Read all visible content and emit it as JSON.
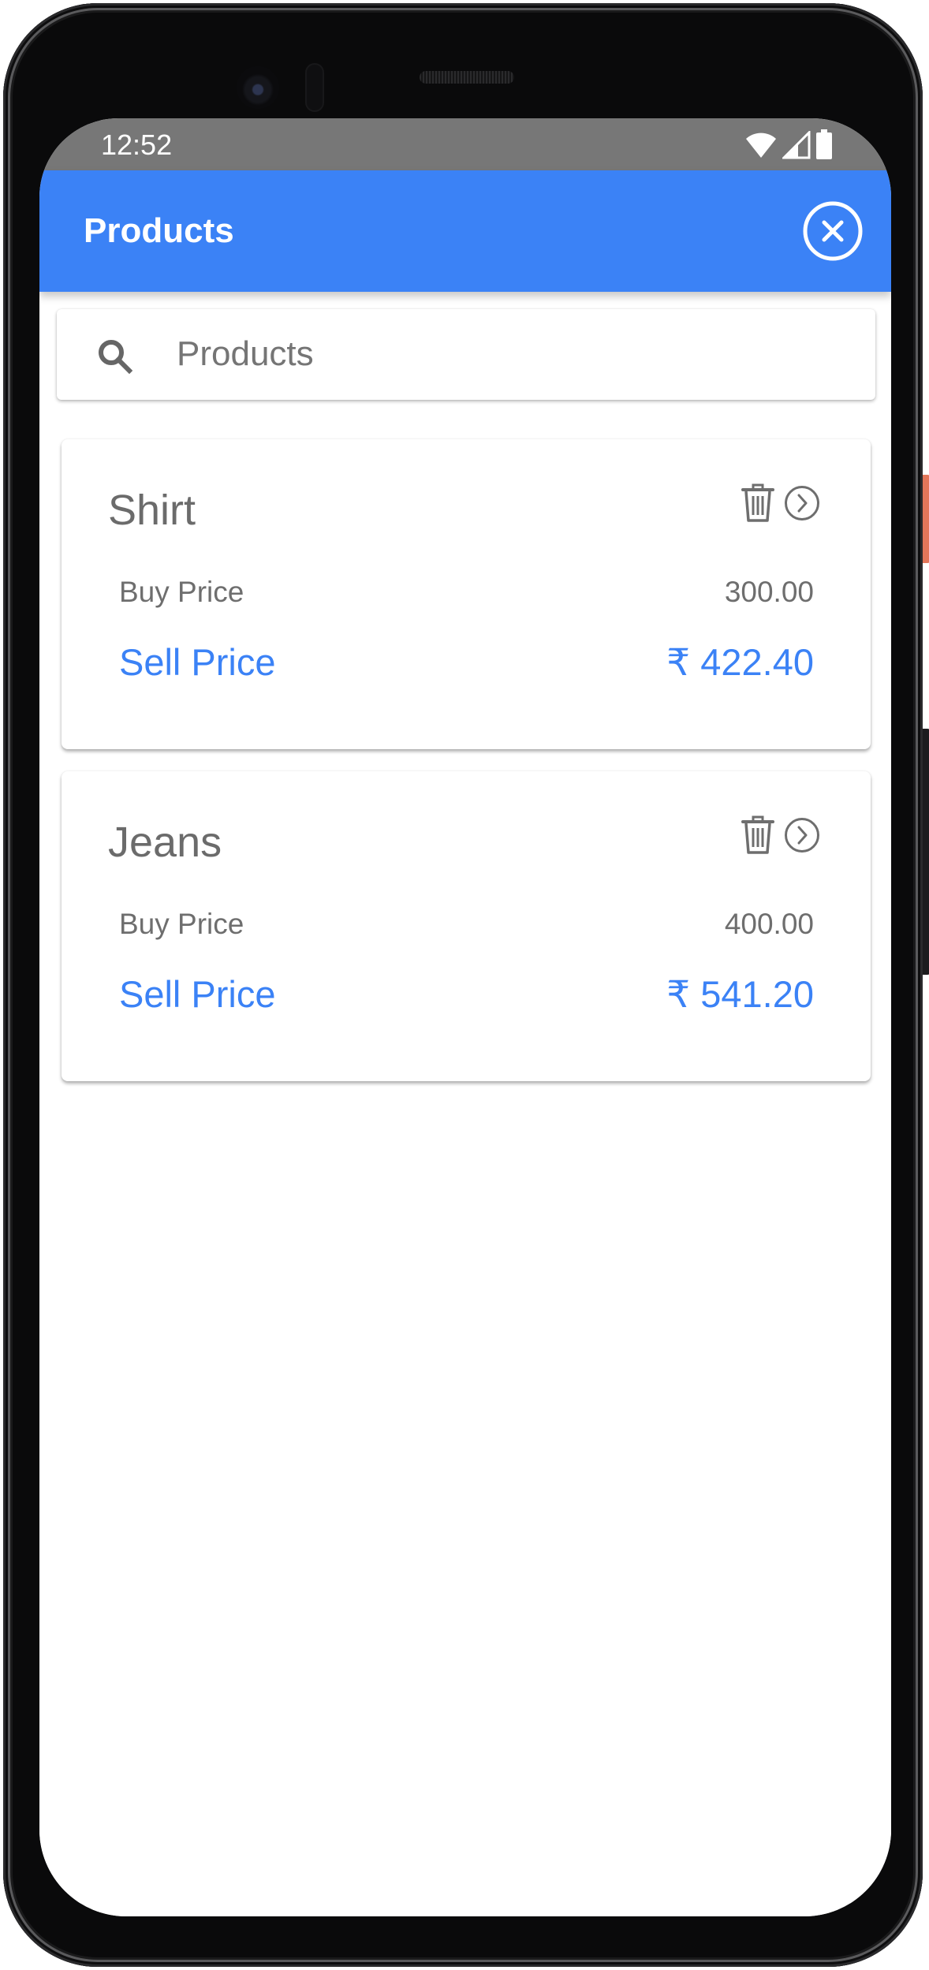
{
  "status_bar": {
    "time": "12:52",
    "icons": [
      "wifi-icon",
      "signal-icon",
      "battery-icon"
    ]
  },
  "appbar": {
    "title": "Products",
    "close_icon": "close-circle-icon"
  },
  "search": {
    "value": "",
    "placeholder": "Products",
    "icon": "search-icon"
  },
  "products": [
    {
      "name": "Shirt",
      "buy_label": "Buy Price",
      "buy_price": "300.00",
      "sell_label": "Sell Price",
      "sell_price": "₹ 422.40"
    },
    {
      "name": "Jeans",
      "buy_label": "Buy Price",
      "buy_price": "400.00",
      "sell_label": "Sell Price",
      "sell_price": "₹ 541.20"
    }
  ],
  "colors": {
    "primary": "#3b82f6",
    "status_bar": "#777777",
    "text_secondary": "#6e6e6e"
  }
}
